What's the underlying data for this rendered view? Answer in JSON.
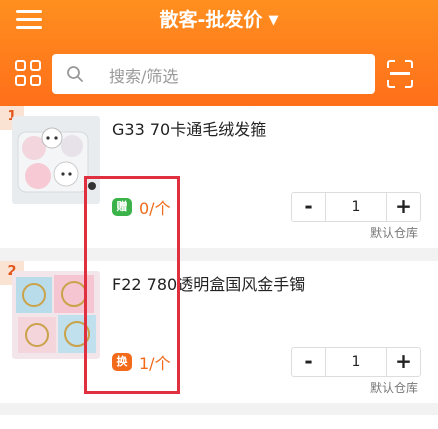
{
  "header": {
    "title": "散客-批发价",
    "caret": "▼",
    "search_placeholder": "搜索/筛选"
  },
  "products": [
    {
      "index": "1",
      "name": "G33 70卡通毛绒发箍",
      "badge": "赠",
      "qty_text": "0/个",
      "stepper": {
        "minus": "-",
        "value": "1",
        "plus": "+"
      },
      "warehouse": "默认仓库"
    },
    {
      "index": "2",
      "name": "F22 780透明盒国风金手镯",
      "badge": "换",
      "qty_text": "1/个",
      "stepper": {
        "minus": "-",
        "value": "1",
        "plus": "+"
      },
      "warehouse": "默认仓库"
    }
  ],
  "colors": {
    "header": "#ff7a1d",
    "badge_gift": "#3bb34a",
    "badge_swap": "#f46a1b",
    "qty": "#f06a1a",
    "highlight_box": "#e03040"
  }
}
